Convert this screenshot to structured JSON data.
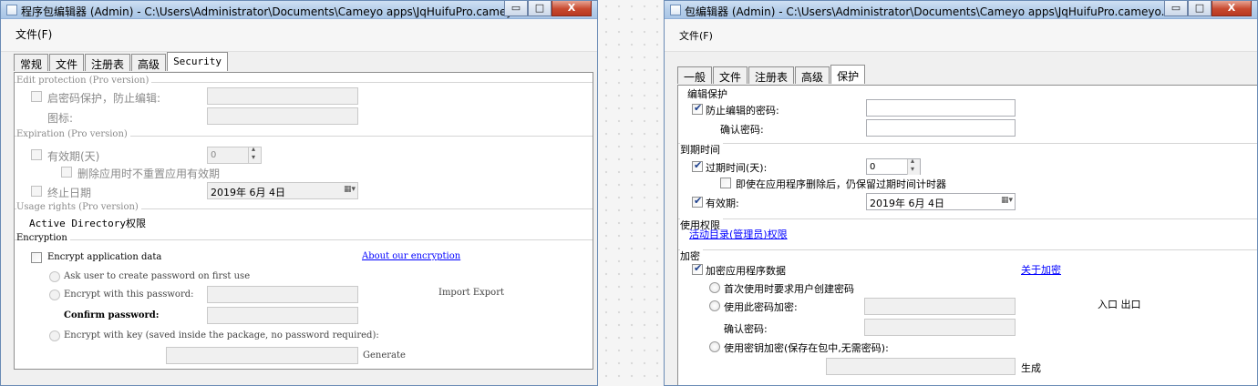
{
  "left_window": {
    "title": "程序包编辑器 (Admin) - C:\\Users\\Administrator\\Documents\\Cameyo apps\\JqHuifuPro.cameyo....",
    "menu_file": "文件(F)",
    "tabs": [
      "常规",
      "文件",
      "注册表",
      "高级",
      "Security"
    ],
    "edit_protection": {
      "section": "Edit protection (Pro version)",
      "password_label": "启密码保护，防止编辑:",
      "icon_label": "图标:"
    },
    "expiration": {
      "section": "Expiration (Pro version)",
      "days_label": "有效期(天)",
      "days_value": "0",
      "no_reset_label": "删除应用时不重置应用有效期",
      "end_date_label": "终止日期",
      "end_date_value": "2019年 6月 4日"
    },
    "usage_rights": {
      "section": "Usage rights (Pro version)",
      "ad_label": "Active Directory权限"
    },
    "encryption": {
      "section": "Encryption",
      "encrypt_label": "Encrypt application data",
      "about_link": "About our encryption",
      "ask_user_label": "Ask user to create password on first use",
      "encrypt_password_label": "Encrypt with this password:",
      "import_export": "Import Export",
      "confirm_label": "Confirm password:",
      "encrypt_key_label": "Encrypt with key (saved inside the package, no password required):",
      "generate_label": "Generate"
    }
  },
  "right_window": {
    "title": "包编辑器 (Admin) - C:\\Users\\Administrator\\Documents\\Cameyo apps\\JqHuifuPro.cameyo.exe",
    "menu_file": "文件(F)",
    "tabs": [
      "一般",
      "文件",
      "注册表",
      "高级",
      "保护"
    ],
    "edit_protection": {
      "section": "编辑保护",
      "password_label": "防止编辑的密码:",
      "confirm_label": "确认密码:"
    },
    "expiration": {
      "section": "到期时间",
      "days_label": "过期时间(天):",
      "days_value": "0",
      "keep_label": "即使在应用程序删除后，仍保留过期时间计时器",
      "valid_label": "有效期:",
      "valid_value": "2019年 6月 4日"
    },
    "usage_rights": {
      "section": "使用权限",
      "ad_link": "活动目录(管理员)权限"
    },
    "encryption": {
      "section": "加密",
      "encrypt_label": "加密应用程序数据",
      "about_link": "关于加密",
      "ask_user_label": "首次使用时要求用户创建密码",
      "encrypt_password_label": "使用此密码加密:",
      "import_export": "入口 出口",
      "confirm_label": "确认密码:",
      "encrypt_key_label": "使用密钥加密(保存在包中,无需密码):",
      "generate_label": "生成"
    }
  },
  "window_controls": {
    "minimize": "▭",
    "maximize": "□",
    "close": "X"
  }
}
